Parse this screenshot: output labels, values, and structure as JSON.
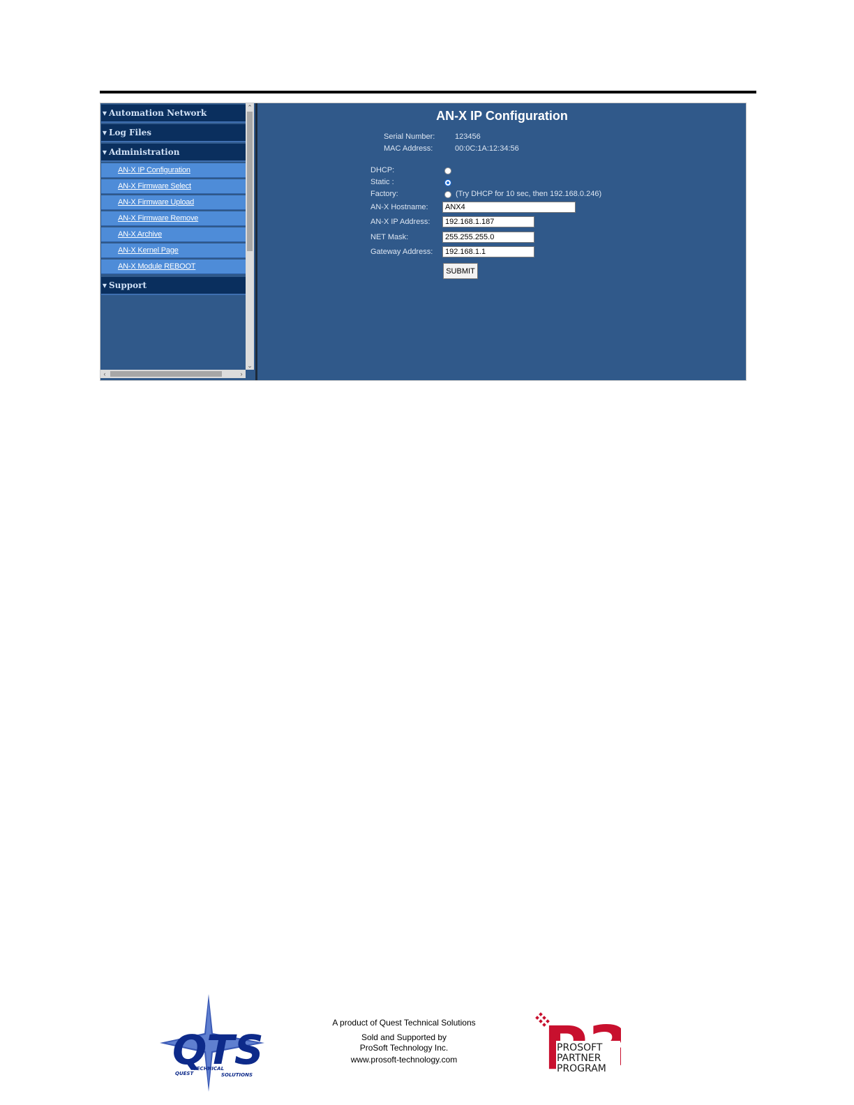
{
  "nav": {
    "sections": [
      {
        "label": "Automation Network",
        "icon": "chevron-down-icon"
      },
      {
        "label": "Log Files",
        "icon": "chevron-down-icon"
      },
      {
        "label": "Administration",
        "icon": "chevron-down-icon"
      }
    ],
    "admin_items": [
      "AN-X IP Configuration",
      "AN-X Firmware Select",
      "AN-X Firmware Upload",
      "AN-X Firmware Remove",
      "AN-X Archive",
      "AN-X Kernel Page",
      "AN-X Module REBOOT"
    ],
    "support_label": "Support"
  },
  "main": {
    "title": "AN-X IP Configuration",
    "serial_label": "Serial Number:",
    "serial_value": "123456",
    "mac_label": "MAC Address:",
    "mac_value": "00:0C:1A:12:34:56",
    "dhcp_label": "DHCP:",
    "static_label": "Static :",
    "factory_label": "Factory:",
    "factory_note": "(Try DHCP for 10 sec, then 192.168.0.246)",
    "selected_mode": "Static",
    "hostname_label": "AN-X Hostname:",
    "hostname_value": "ANX4",
    "ip_label": "AN-X IP Address:",
    "ip_value": "192.168.1.187",
    "mask_label": "NET Mask:",
    "mask_value": "255.255.255.0",
    "gateway_label": "Gateway Address:",
    "gateway_value": "192.168.1.1",
    "submit_label": "SUBMIT"
  },
  "footer": {
    "product_line": "A product of Quest Technical Solutions",
    "sold_line": "Sold and Supported by",
    "company_line": "ProSoft Technology Inc.",
    "url_line": "www.prosoft-technology.com",
    "qts_logo": {
      "letters": "QTS",
      "words": [
        "QUEST",
        "TECHNICAL",
        "SOLUTIONS"
      ]
    },
    "p3_logo": {
      "mark": "P3",
      "lines": [
        "PROSOFT",
        "PARTNER",
        "PROGRAM"
      ]
    }
  },
  "colors": {
    "panel": "#30598a",
    "nav_section": "#0a2f5e",
    "nav_item": "#4e8cd8",
    "qts_blue": "#0d2a8a",
    "p3_red": "#c8102e"
  }
}
